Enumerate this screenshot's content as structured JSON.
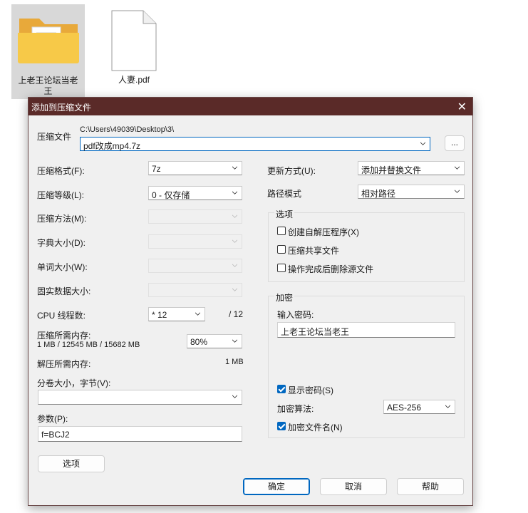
{
  "desktop": {
    "folder_label": "上老王论坛当老王",
    "file_label": "人妻.pdf"
  },
  "dialog": {
    "title": "添加到压缩文件",
    "archive_label": "压缩文件",
    "archive_path": "C:\\Users\\49039\\Desktop\\3\\",
    "archive_name": "pdf改成mp4.7z",
    "browse_label": "...",
    "left": {
      "format_label": "压缩格式(F):",
      "format_value": "7z",
      "level_label": "压缩等级(L):",
      "level_value": "0 - 仅存储",
      "method_label": "压缩方法(M):",
      "dict_label": "字典大小(D):",
      "word_label": "单词大小(W):",
      "solid_label": "固实数据大小:",
      "cpu_label": "CPU 线程数:",
      "cpu_value": "* 12",
      "cpu_total": "/ 12",
      "mem_comp_label": "压缩所需内存:",
      "mem_comp_detail": "1 MB / 12545 MB / 15682 MB",
      "mem_percent": "80%",
      "mem_decomp_label": "解压所需内存:",
      "mem_decomp_value": "1 MB",
      "split_label": "分卷大小，字节(V):",
      "split_value": "",
      "params_label": "参数(P):",
      "params_value": "f=BCJ2",
      "options_button": "选项"
    },
    "right": {
      "update_label": "更新方式(U):",
      "update_value": "添加并替换文件",
      "path_label": "路径模式",
      "path_value": "相对路径",
      "options_group": "选项",
      "opt_sfx": "创建自解压程序(X)",
      "opt_shared": "压缩共享文件",
      "opt_delete": "操作完成后删除源文件",
      "encrypt_group": "加密",
      "password_label": "输入密码:",
      "password_value": "上老王论坛当老王",
      "show_password": "显示密码(S)",
      "algo_label": "加密算法:",
      "algo_value": "AES-256",
      "encrypt_names": "加密文件名(N)"
    },
    "buttons": {
      "ok": "确定",
      "cancel": "取消",
      "help": "帮助"
    }
  },
  "colors": {
    "titlebar": "#5a2a28",
    "accent": "#0067c0",
    "folder": "#f7c948"
  }
}
